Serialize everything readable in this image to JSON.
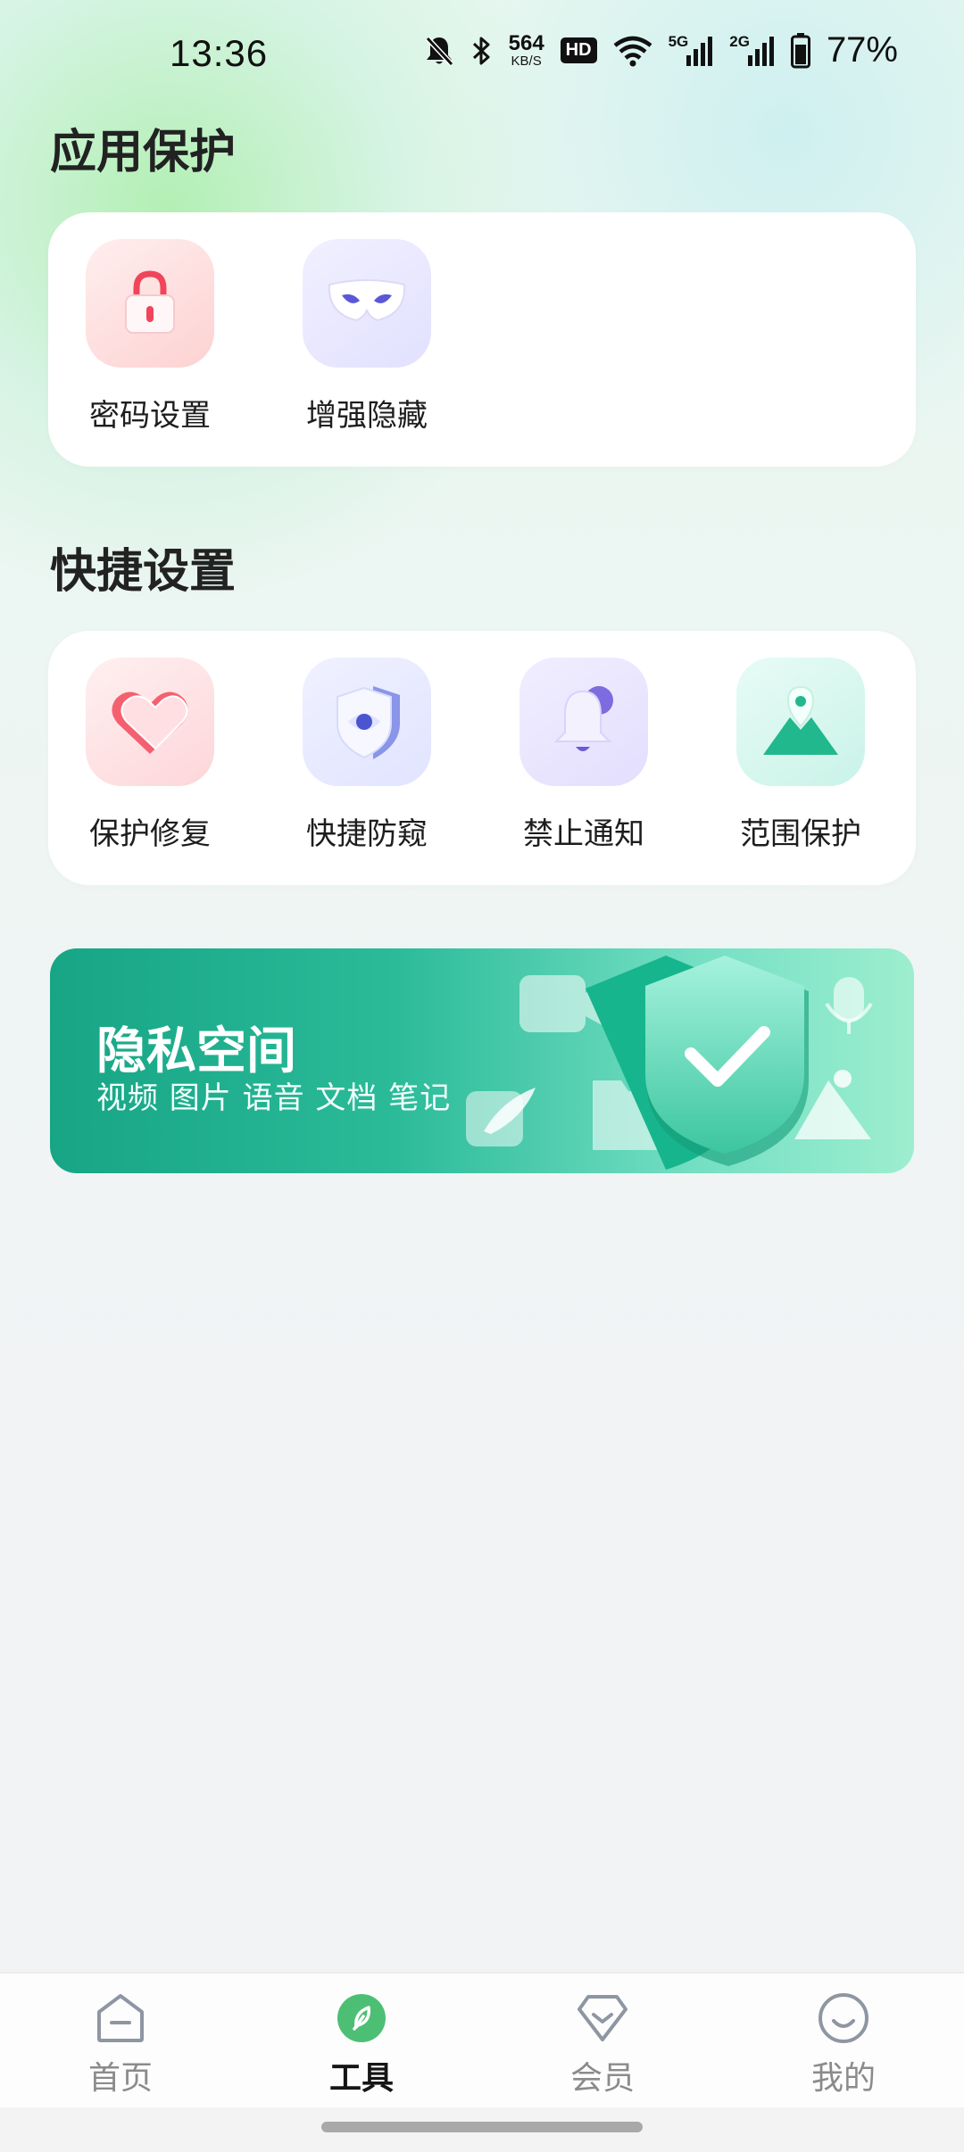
{
  "status_bar": {
    "time": "13:36",
    "net_speed_value": "564",
    "net_speed_unit": "KB/S",
    "hd_badge": "HD",
    "sim1_label": "5G",
    "sim2_label": "2G",
    "battery_percent": "77%",
    "icons": [
      "mute-bell-icon",
      "bluetooth-icon",
      "wifi-icon",
      "signal-icon",
      "battery-icon"
    ]
  },
  "app_protection": {
    "title": "应用保护",
    "items": [
      {
        "label": "密码设置",
        "icon": "lock-icon"
      },
      {
        "label": "增强隐藏",
        "icon": "mask-icon"
      }
    ]
  },
  "quick_settings": {
    "title": "快捷设置",
    "items": [
      {
        "label": "保护修复",
        "icon": "heart-icon"
      },
      {
        "label": "快捷防窥",
        "icon": "shield-eye-icon"
      },
      {
        "label": "禁止通知",
        "icon": "bell-icon"
      },
      {
        "label": "范围保护",
        "icon": "location-mountain-icon"
      }
    ]
  },
  "banner": {
    "title": "隐私空间",
    "subtitle": "视频 图片 语音 文档 笔记",
    "icons": [
      "video-icon",
      "note-icon",
      "folder-icon",
      "shield-check-icon",
      "voice-icon",
      "image-icon"
    ],
    "colors": {
      "start": "#17a585",
      "end": "#9deecf"
    }
  },
  "bottom_nav": {
    "active": "工具",
    "items": [
      {
        "label": "首页",
        "icon": "home-icon"
      },
      {
        "label": "工具",
        "icon": "tool-leaf-icon"
      },
      {
        "label": "会员",
        "icon": "member-diamond-icon"
      },
      {
        "label": "我的",
        "icon": "profile-smile-icon"
      }
    ]
  }
}
